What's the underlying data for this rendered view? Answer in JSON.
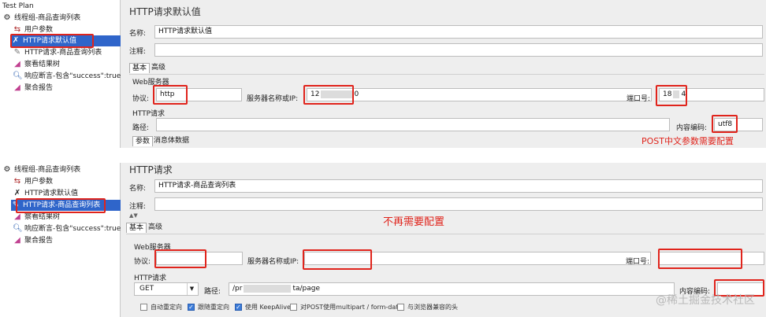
{
  "top": {
    "tree": {
      "root": "Test Plan",
      "items": [
        {
          "label": "线程组-商品查询列表",
          "icon": "thread-group-icon"
        },
        {
          "label": "用户参数",
          "icon": "user-params-icon"
        },
        {
          "label": "HTTP请求默认值",
          "icon": "http-defaults-icon"
        },
        {
          "label": "HTTP请求-商品查询列表",
          "icon": "http-sampler-icon"
        },
        {
          "label": "察看结果树",
          "icon": "results-tree-icon"
        },
        {
          "label": "响应断言-包含\"success\":true",
          "icon": "assertion-icon"
        },
        {
          "label": "聚合报告",
          "icon": "aggregate-report-icon"
        }
      ]
    },
    "panel": {
      "title": "HTTP请求默认值",
      "name_label": "名称:",
      "name_value": "HTTP请求默认值",
      "comment_label": "注释:",
      "tabs": [
        "基本",
        "高级"
      ],
      "web_server_section": "Web服务器",
      "protocol_label": "协议:",
      "protocol_value": "http",
      "server_label": "服务器名称或IP:",
      "server_value_start": "12",
      "server_value_end": "0",
      "port_label": "端口号:",
      "port_value_start": "18",
      "port_value_end": "4",
      "http_section": "HTTP请求",
      "path_label": "路径:",
      "encoding_label": "内容编码:",
      "encoding_value": "utf8",
      "subtabs": [
        "参数",
        "消息体数据"
      ],
      "note": "POST中文参数需要配置"
    }
  },
  "bottom": {
    "tree": {
      "items": [
        {
          "label": "线程组-商品查询列表",
          "icon": "thread-group-icon"
        },
        {
          "label": "用户参数",
          "icon": "user-params-icon"
        },
        {
          "label": "HTTP请求默认值",
          "icon": "http-defaults-icon"
        },
        {
          "label": "HTTP请求-商品查询列表",
          "icon": "http-sampler-icon"
        },
        {
          "label": "察看结果树",
          "icon": "results-tree-icon"
        },
        {
          "label": "响应断言-包含\"success\":true",
          "icon": "assertion-icon"
        },
        {
          "label": "聚合报告",
          "icon": "aggregate-report-icon"
        }
      ]
    },
    "panel": {
      "title": "HTTP请求",
      "name_label": "名称:",
      "name_value": "HTTP请求-商品查询列表",
      "comment_label": "注释:",
      "note": "不再需要配置",
      "tabs": [
        "基本",
        "高级"
      ],
      "web_server_section": "Web服务器",
      "protocol_label": "协议:",
      "server_label": "服务器名称或IP:",
      "port_label": "端口号:",
      "http_section": "HTTP请求",
      "method_value": "GET",
      "path_label": "路径:",
      "path_value_start": "/pr",
      "path_value_end": "ta/page",
      "encoding_label": "内容编码:",
      "checkboxes": [
        {
          "label": "自动重定向",
          "checked": false
        },
        {
          "label": "跟随重定向",
          "checked": true
        },
        {
          "label": "使用 KeepAlive",
          "checked": true
        },
        {
          "label": "对POST使用multipart / form-data",
          "checked": false
        },
        {
          "label": "与浏览器兼容的头",
          "checked": false
        }
      ]
    }
  },
  "watermark": "@稀土掘金技术社区",
  "colors": {
    "highlight": "#e0241c",
    "selection": "#2f65ca"
  }
}
